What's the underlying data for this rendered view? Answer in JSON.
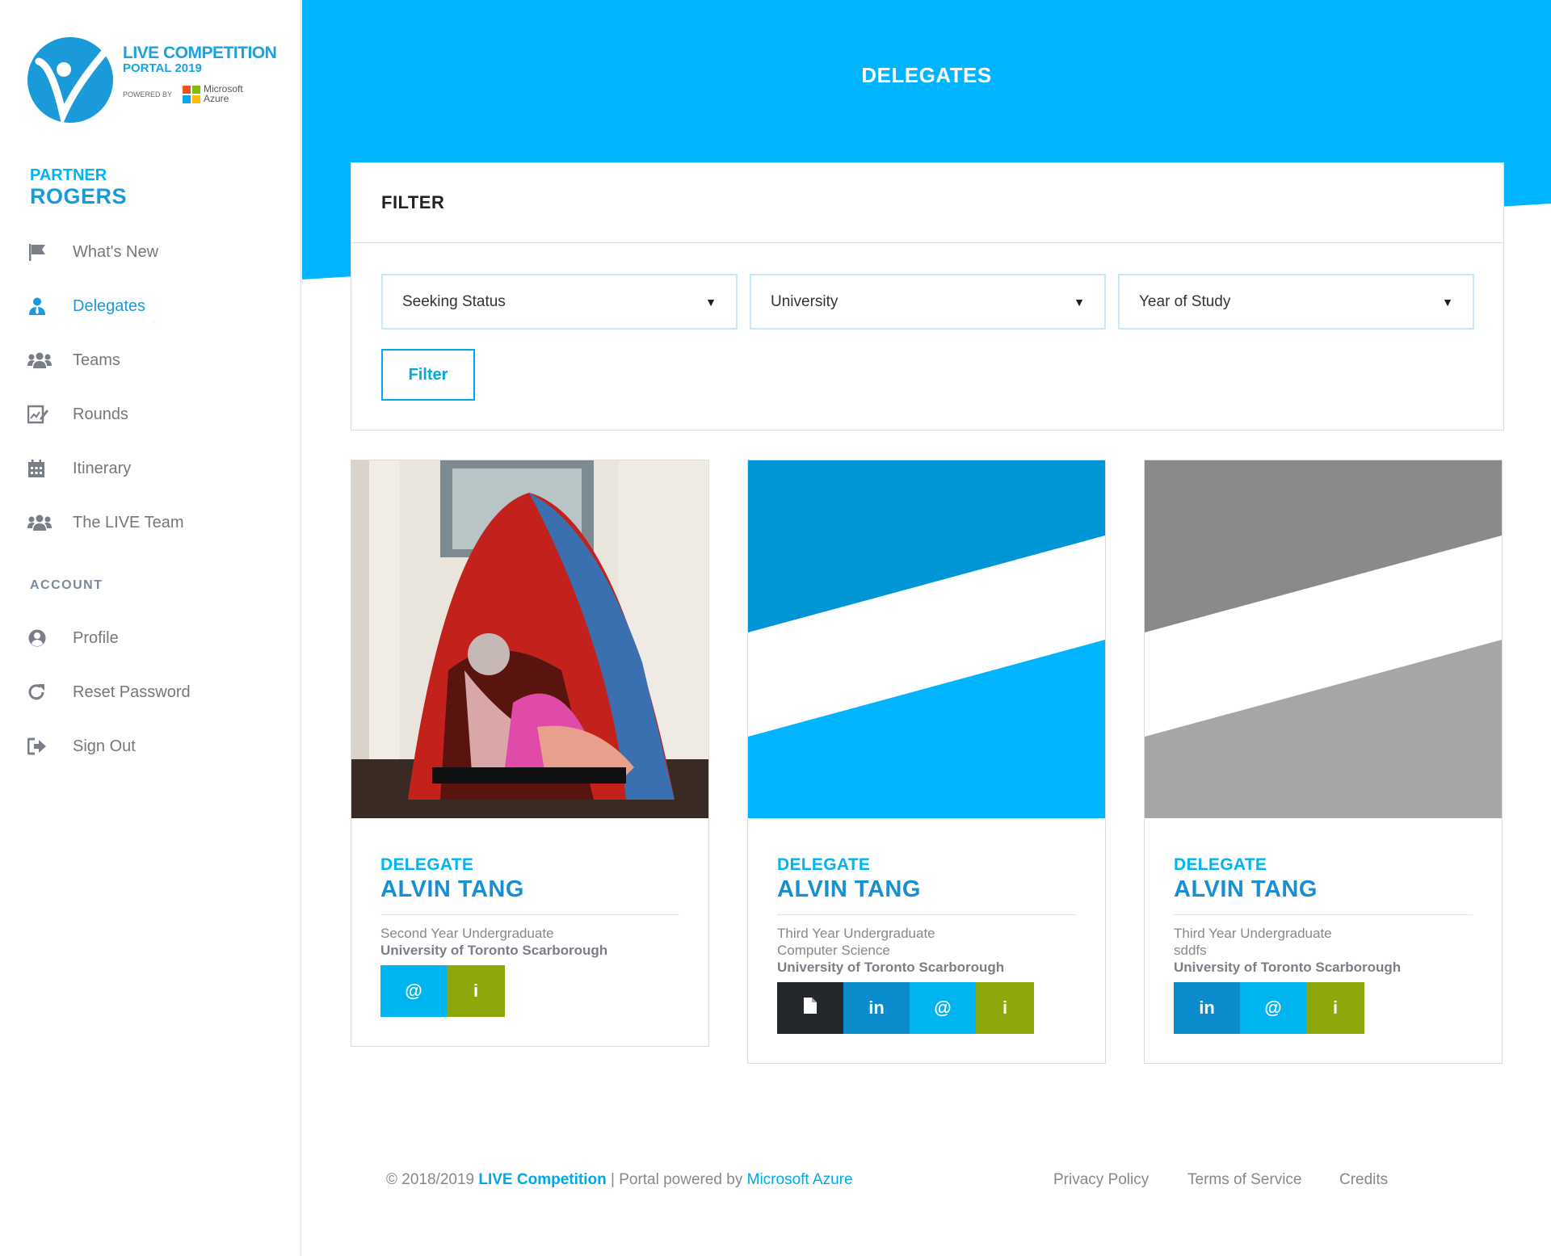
{
  "brand": {
    "line1": "LIVE COMPETITION",
    "line2": "PORTAL 2019",
    "powered_by": "POWERED BY",
    "ms_line1": "Microsoft",
    "ms_line2": "Azure",
    "colors": {
      "blue": "#00b4f0",
      "dark_blue": "#1a9ad9"
    }
  },
  "sidebar": {
    "partner_label": "PARTNER",
    "partner_name": "ROGERS",
    "nav": [
      {
        "label": "What's New",
        "icon": "flag-icon"
      },
      {
        "label": "Delegates",
        "icon": "user-tie-icon",
        "active": true
      },
      {
        "label": "Teams",
        "icon": "users-icon"
      },
      {
        "label": "Rounds",
        "icon": "edit-chart-icon"
      },
      {
        "label": "Itinerary",
        "icon": "calendar-icon"
      },
      {
        "label": "The LIVE Team",
        "icon": "users-icon"
      }
    ],
    "account_label": "ACCOUNT",
    "account": [
      {
        "label": "Profile",
        "icon": "user-circle-icon"
      },
      {
        "label": "Reset Password",
        "icon": "redo-icon"
      },
      {
        "label": "Sign Out",
        "icon": "sign-out-icon"
      }
    ]
  },
  "header": {
    "title": "DELEGATES"
  },
  "filter": {
    "title": "FILTER",
    "selects": [
      {
        "selected": "Seeking Status"
      },
      {
        "selected": "University"
      },
      {
        "selected": "Year of Study"
      }
    ],
    "button_label": "Filter"
  },
  "delegates": [
    {
      "role": "DELEGATE",
      "name": "ALVIN TANG",
      "year": "Second Year Undergraduate",
      "program": "",
      "university": "University of Toronto Scarborough",
      "media": "photo",
      "actions": [
        "@",
        "i"
      ]
    },
    {
      "role": "DELEGATE",
      "name": "ALVIN TANG",
      "year": "Third Year Undergraduate",
      "program": "Computer Science",
      "university": "University of Toronto Scarborough",
      "media": "blue-placeholder",
      "actions": [
        "cv",
        "in",
        "@",
        "i"
      ]
    },
    {
      "role": "DELEGATE",
      "name": "ALVIN TANG",
      "year": "Third Year Undergraduate",
      "program": "sddfs",
      "university": "University of Toronto Scarborough",
      "media": "grey-placeholder",
      "actions": [
        "in",
        "@",
        "i"
      ]
    }
  ],
  "footer": {
    "copyright": "© 2018/2019",
    "brand": "LIVE Competition",
    "separator": "| Portal powered by",
    "powered": "Microsoft Azure",
    "links": [
      "Privacy Policy",
      "Terms of Service",
      "Credits"
    ]
  }
}
